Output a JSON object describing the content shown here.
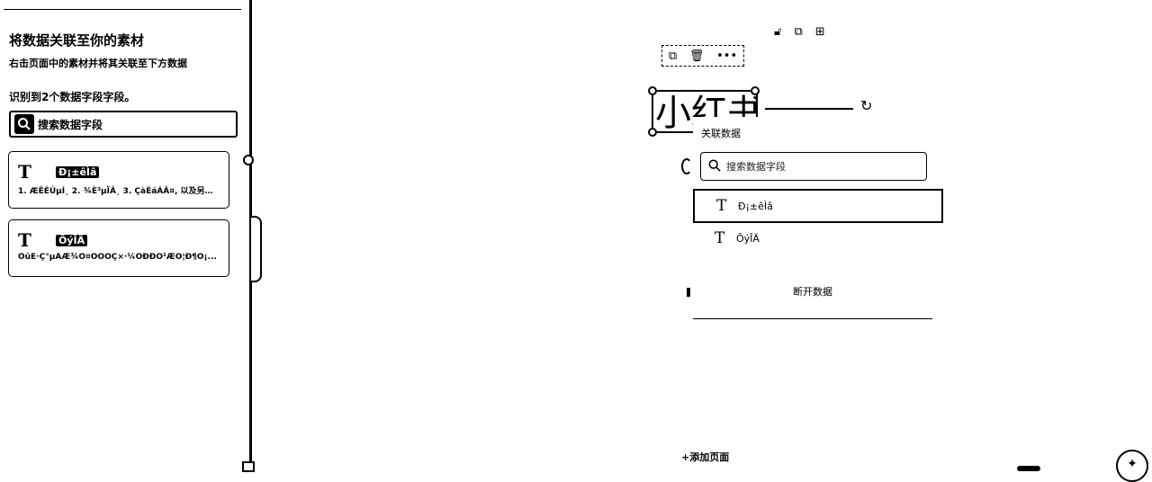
{
  "left_panel": {
    "title": "将数据关联至你的素材",
    "subtitle": "右击页面中的素材并将其关联至下方数据",
    "count_text": "识别到2个数据字段字段。",
    "search_placeholder": "搜索数据字段",
    "fields": [
      {
        "icon": "text-type-icon",
        "icon_glyph": "T",
        "name": "Ð¡±êÌâ",
        "desc": "1. ÆÊÉÚµÍ¸ 2. ¾È³µÏÂ¸ 3. ÇàÉáÁÂ¤, 以及另外..."
      },
      {
        "icon": "text-type-icon",
        "icon_glyph": "T",
        "name": "ÕýÎÄ",
        "desc": "ÕûÊ·Ç°µÄÆ¾Ö¤ÒÔÔÇ×·¼ÓÐÐÕ¹ÆÓ¦Ð¶Ô¡..."
      }
    ]
  },
  "canvas": {
    "top_tools": [
      {
        "name": "lock-icon",
        "glyph": "🔓︎"
      },
      {
        "name": "duplicate-page-icon",
        "glyph": "⧉"
      },
      {
        "name": "add-page-icon",
        "glyph": "⊞"
      }
    ],
    "selection_toolbar": [
      {
        "name": "copy-icon",
        "glyph": "⧉"
      },
      {
        "name": "delete-icon",
        "glyph": "🗑︎"
      },
      {
        "name": "more-icon",
        "glyph": "•••"
      }
    ],
    "element_text": "小红书",
    "refresh_glyph": "↻",
    "add_page_label": "+添加页面",
    "assistant_glyph": "✦"
  },
  "dropdown": {
    "title": "关联数据",
    "search_placeholder": "搜索数据字段",
    "items": [
      {
        "glyph": "T",
        "label": "Ð¡±êÌâ",
        "active": true
      },
      {
        "glyph": "T",
        "label": "ÕýÎÄ",
        "active": false
      }
    ],
    "disconnect_label": "断开数据"
  }
}
